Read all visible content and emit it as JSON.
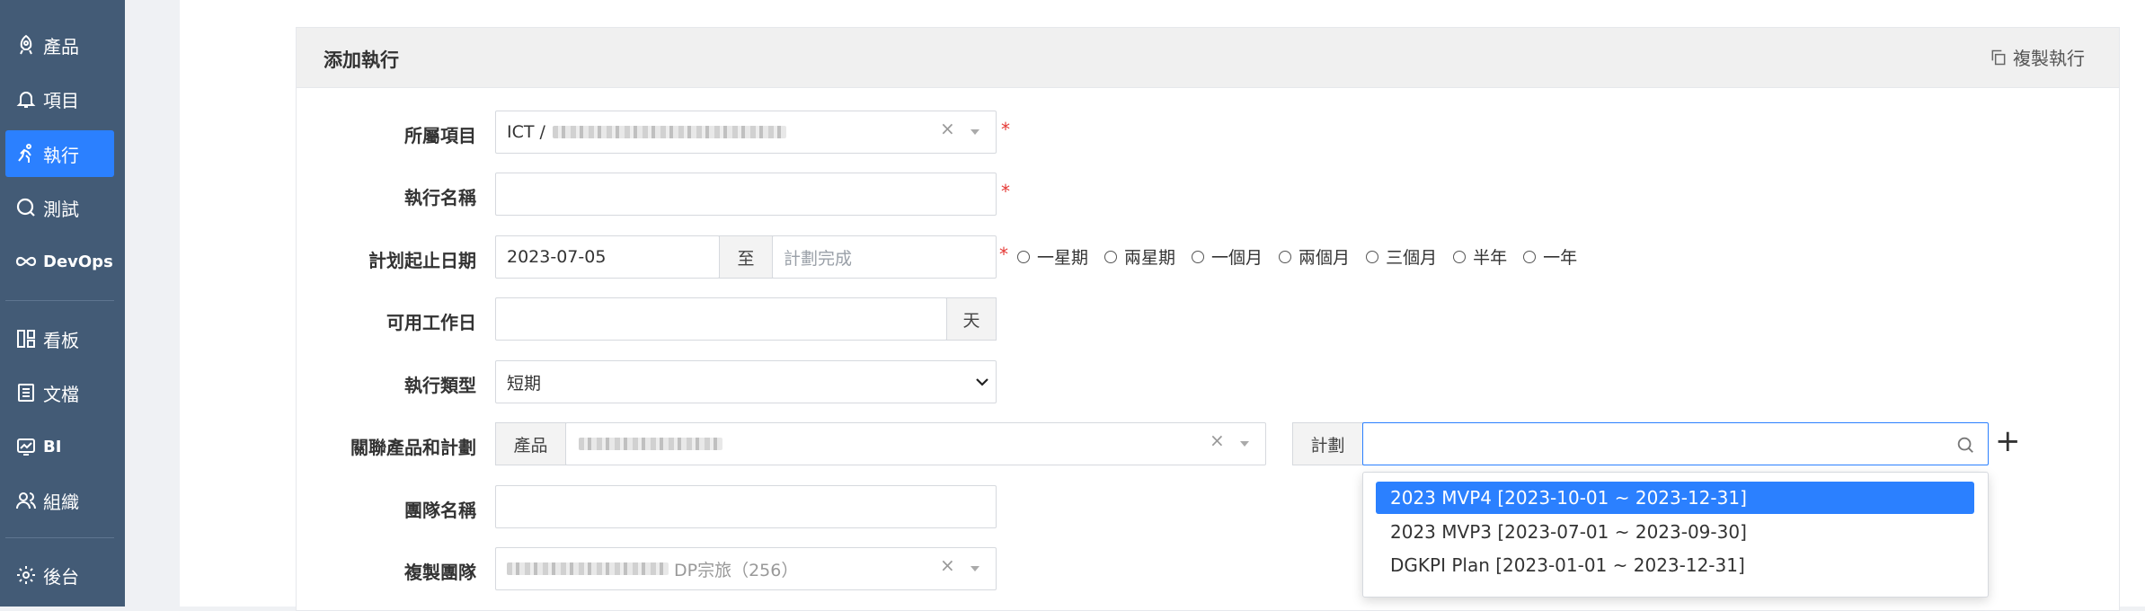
{
  "sidebar": {
    "items": [
      {
        "label": "產品",
        "icon": "rocket-icon"
      },
      {
        "label": "項目",
        "icon": "bell-icon"
      },
      {
        "label": "執行",
        "icon": "runner-icon"
      },
      {
        "label": "測試",
        "icon": "magnifier-icon"
      },
      {
        "label": "DevOps",
        "icon": "infinity-icon"
      },
      {
        "label": "看板",
        "icon": "kanban-icon"
      },
      {
        "label": "文檔",
        "icon": "document-icon"
      },
      {
        "label": "BI",
        "icon": "monitor-chart-icon"
      },
      {
        "label": "組織",
        "icon": "users-icon"
      },
      {
        "label": "後台",
        "icon": "gear-icon"
      }
    ],
    "active": "執行",
    "colors": {
      "bg": "#435b76",
      "active": "#2b80ff"
    }
  },
  "panel": {
    "title": "添加執行",
    "copy_label": "複製執行"
  },
  "form": {
    "project": {
      "label": "所屬項目",
      "value_prefix": "ICT /"
    },
    "name": {
      "label": "執行名稱",
      "value": ""
    },
    "dates": {
      "label": "計划起止日期",
      "begin": "2023-07-05",
      "sep": "至",
      "end_placeholder": "計劃完成",
      "durations": [
        "一星期",
        "兩星期",
        "一個月",
        "兩個月",
        "三個月",
        "半年",
        "一年"
      ]
    },
    "days": {
      "label": "可用工作日",
      "unit": "天",
      "value": ""
    },
    "type": {
      "label": "執行類型",
      "value": "短期"
    },
    "products": {
      "label": "關聯產品和計劃",
      "product_addon": "產品",
      "plan_addon": "計劃"
    },
    "team": {
      "label": "團隊名稱",
      "value": ""
    },
    "copy_team": {
      "label": "複製團隊",
      "value_fragment": "DP宗旅（256）"
    }
  },
  "plan_dropdown": {
    "options": [
      "2023 MVP4 [2023-10-01 ~ 2023-12-31]",
      "2023 MVP3 [2023-07-01 ~ 2023-09-30]",
      "DGKPI Plan [2023-01-01 ~ 2023-12-31]"
    ],
    "highlighted": 0
  }
}
